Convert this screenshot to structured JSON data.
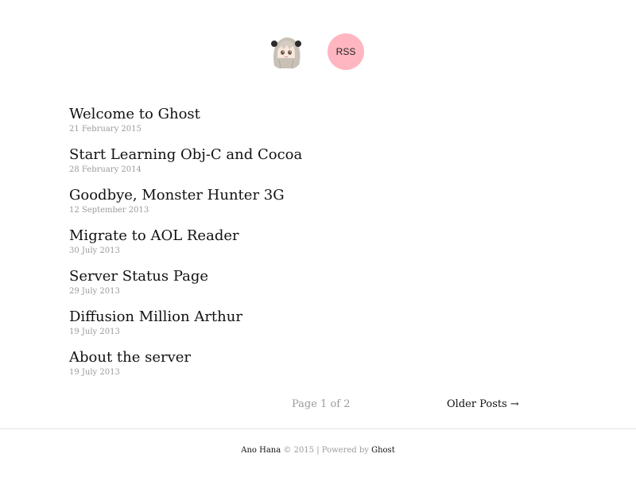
{
  "header": {
    "avatar_icon": "anime-girl-avatar-icon",
    "rss_label": "RSS",
    "rss_color": "#ffb6c1"
  },
  "posts": [
    {
      "title": "Welcome to Ghost",
      "date": "21 February 2015"
    },
    {
      "title": "Start Learning Obj-C and Cocoa",
      "date": "28 February 2014"
    },
    {
      "title": "Goodbye, Monster Hunter 3G",
      "date": "12 September 2013"
    },
    {
      "title": "Migrate to AOL Reader",
      "date": "30 July 2013"
    },
    {
      "title": "Server Status Page",
      "date": "29 July 2013"
    },
    {
      "title": "Diffusion Million Arthur",
      "date": "19 July 2013"
    },
    {
      "title": "About the server",
      "date": "19 July 2013"
    }
  ],
  "pagination": {
    "page_info": "Page 1 of 2",
    "older_label": "Older Posts →"
  },
  "footer": {
    "site_name": "Ano Hana",
    "copyright": "© 2015 | Powered by",
    "ghost_link": "Ghost"
  }
}
